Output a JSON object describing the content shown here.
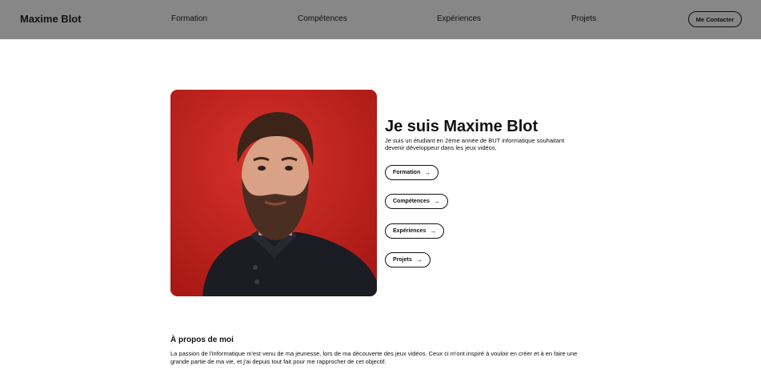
{
  "nav": {
    "brand": "Maxime Blot",
    "links": [
      "Formation",
      "Compétences",
      "Expériences",
      "Projets"
    ],
    "contact": "Me Contacter"
  },
  "hero": {
    "title": "Je suis Maxime Blot",
    "text": "Je suis un étudiant en 2ème année de BUT informatique souhaitant devenir développeur dans les jeux vidéos.",
    "buttons": [
      "Formation",
      "Compétences",
      "Expériences",
      "Projets"
    ],
    "arrow_icon": "arrow-right-icon"
  },
  "about": {
    "title": "À propos de moi",
    "text": "La passion de l'informatique m'est venu de ma jeunesse, lors de ma découverte des jeux vidéos. Ceux ci m'ont inspiré à vouloir en créer et à en faire une grande partie de ma vie, et j'ai depuis tout fait pour me rapprocher de cet objectif."
  },
  "colors": {
    "navbar": "#878787",
    "photo_background": "#c92622"
  }
}
